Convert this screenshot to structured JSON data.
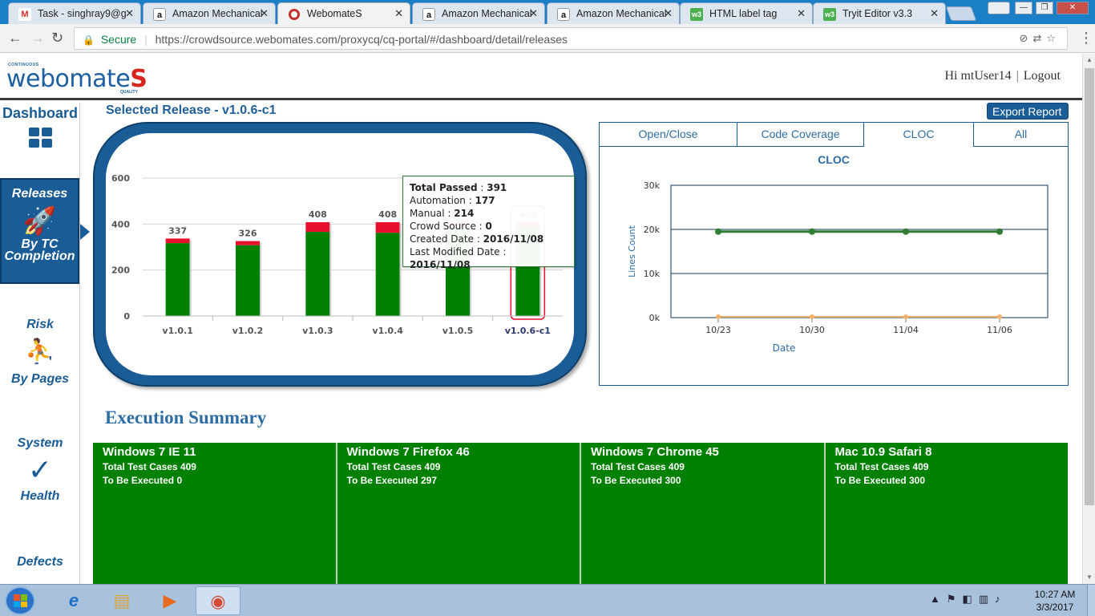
{
  "browser": {
    "tabs": [
      {
        "title": "Task - singhray9@g",
        "favicon": "gmail-icon"
      },
      {
        "title": "Amazon Mechanical",
        "favicon": "amazon-icon"
      },
      {
        "title": "WebomateS",
        "favicon": "webomates-icon"
      },
      {
        "title": "Amazon Mechanical",
        "favicon": "amazon-icon"
      },
      {
        "title": "Amazon Mechanical",
        "favicon": "amazon-icon"
      },
      {
        "title": "HTML label tag",
        "favicon": "w3schools-icon"
      },
      {
        "title": "Tryit Editor v3.3",
        "favicon": "w3schools-icon"
      }
    ],
    "active_tab_index": 2,
    "secure_label": "Secure",
    "url": "https://crowdsource.webomates.com/proxycq/cq-portal/#/dashboard/detail/releases"
  },
  "header": {
    "logo_top": "CONTINUOUS",
    "logo_text": "webomate",
    "logo_s": "S",
    "logo_bottom": "QUALITY",
    "greeting": "Hi mtUser14",
    "logout": "Logout"
  },
  "sidebar": {
    "dashboard": "Dashboard",
    "releases": "Releases",
    "releases_sub": "By TC Completion",
    "risk": "Risk",
    "risk_sub": "By Pages",
    "system": "System",
    "system_sub": "Health",
    "defects": "Defects"
  },
  "main": {
    "selected_release": "Selected Release - v1.0.6-c1",
    "export_report": "Export Report"
  },
  "tooltip": {
    "total_passed_label": "Total Passed",
    "total_passed": "391",
    "automation_label": "Automation",
    "automation": "177",
    "manual_label": "Manual",
    "manual": "214",
    "crowd_label": "Crowd Source",
    "crowd": "0",
    "created_label": "Created Date",
    "created": "2016/11/08",
    "modified_label": "Last Modified Date",
    "modified": "2016/11/08"
  },
  "chart_data": [
    {
      "type": "bar",
      "title": "",
      "categories": [
        "v1.0.1",
        "v1.0.2",
        "v1.0.3",
        "v1.0.4",
        "v1.0.5",
        "v1.0.6-c1"
      ],
      "series": [
        {
          "values": [
            317,
            308,
            366,
            362,
            380,
            391
          ],
          "color": "#008000"
        },
        {
          "values": [
            20,
            18,
            42,
            46,
            29,
            18
          ],
          "color": "#e8112d"
        }
      ],
      "totals": [
        337,
        326,
        408,
        408,
        409,
        409
      ],
      "selected_category": "v1.0.6-c1",
      "yticks": [
        0,
        200,
        400,
        600
      ],
      "ylim": [
        0,
        600
      ],
      "grid": true
    },
    {
      "type": "line",
      "title": "CLOC",
      "xlabel": "Date",
      "ylabel": "Lines Count",
      "x": [
        "10/23",
        "10/30",
        "11/04",
        "11/06"
      ],
      "series": [
        {
          "values": [
            19500,
            19500,
            19500,
            19500
          ],
          "color": "#2e7d32"
        },
        {
          "values": [
            200,
            200,
            200,
            200
          ],
          "color": "#f4b26b"
        }
      ],
      "yticks": [
        "0k",
        "10k",
        "20k",
        "30k"
      ],
      "ylim": [
        0,
        30000
      ],
      "grid": true
    }
  ],
  "cloc_panel": {
    "tabs": [
      "Open/Close",
      "Code Coverage",
      "CLOC",
      "All"
    ],
    "active_tab": "CLOC"
  },
  "execution": {
    "title": "Execution Summary",
    "cards": [
      {
        "name": "Windows 7 IE 11",
        "total": "Total Test Cases 409",
        "pending": "To Be Executed 0"
      },
      {
        "name": "Windows 7 Firefox 46",
        "total": "Total Test Cases 409",
        "pending": "To Be Executed 297"
      },
      {
        "name": "Windows 7 Chrome 45",
        "total": "Total Test Cases 409",
        "pending": "To Be Executed 300"
      },
      {
        "name": "Mac 10.9 Safari 8",
        "total": "Total Test Cases 409",
        "pending": "To Be Executed 300"
      }
    ]
  },
  "taskbar": {
    "time": "10:27 AM",
    "date": "3/3/2017"
  },
  "colors": {
    "brand_blue": "#1a5c96",
    "pass_green": "#008000",
    "fail_red": "#e8112d",
    "accent_red": "#d7261e"
  }
}
